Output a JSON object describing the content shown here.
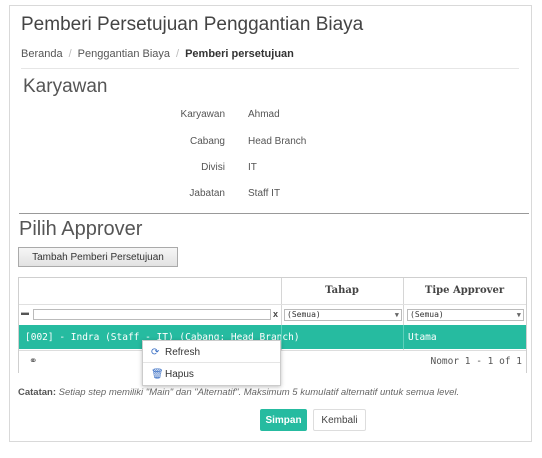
{
  "header": {
    "title": "Pemberi Persetujuan Penggantian Biaya",
    "breadcrumb": [
      "Beranda",
      "Penggantian Biaya",
      "Pemberi persetujuan"
    ]
  },
  "karyawan": {
    "section_title": "Karyawan",
    "fields": [
      {
        "label": "Karyawan",
        "value": "Ahmad"
      },
      {
        "label": "Cabang",
        "value": "Head Branch"
      },
      {
        "label": "Divisi",
        "value": "IT"
      },
      {
        "label": "Jabatan",
        "value": "Staff IT"
      }
    ]
  },
  "approver": {
    "section_title": "Pilih Approver",
    "add_button": "Tambah Pemberi Persetujuan",
    "columns": [
      "",
      "Tahap",
      "Tipe Approver"
    ],
    "filters": {
      "clear": "x",
      "tahap": "(Semua)",
      "tipe": "(Semua)"
    },
    "rows": [
      {
        "name": "[002] - Indra (Staff - IT) (Cabang: Head Branch)",
        "tahap": "",
        "tipe": "Utama"
      }
    ],
    "pager": "Nomor 1 - 1 of 1"
  },
  "context_menu": {
    "items": [
      {
        "icon": "refresh-icon",
        "label": "Refresh"
      },
      {
        "icon": "trash-icon",
        "label": "Hapus"
      }
    ]
  },
  "note": {
    "label": "Catatan:",
    "text": "Setiap step memiliki \"Main\" dan \"Alternatif\". Maksimum 5 kumulatif alternatif untuk semua level."
  },
  "actions": {
    "save": "Simpan",
    "back": "Kembali"
  },
  "colors": {
    "accent": "#26bba0"
  }
}
